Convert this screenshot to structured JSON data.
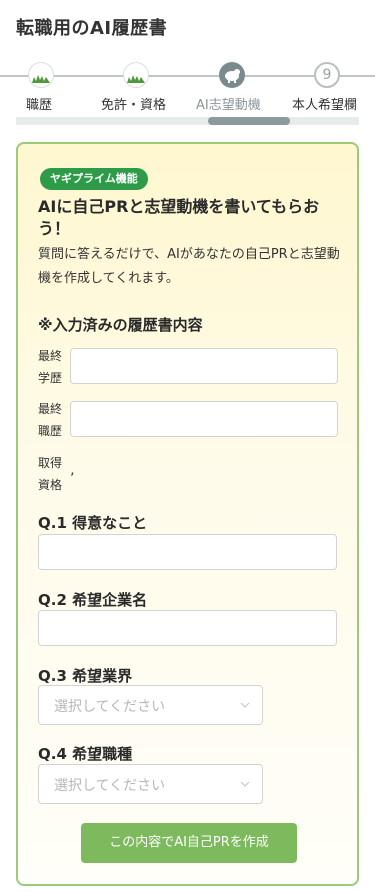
{
  "page": {
    "title": "転職用のAI履歴書"
  },
  "stepper": {
    "steps": [
      {
        "label": "職歴",
        "state": "done"
      },
      {
        "label": "免許・資格",
        "state": "done"
      },
      {
        "label": "AI志望動機",
        "state": "current"
      },
      {
        "label": "本人希望欄",
        "state": "future",
        "number": "9"
      }
    ]
  },
  "card": {
    "badge": "ヤギプライム機能",
    "title": "AIに自己PRと志望動機を書いてもらおう！",
    "description": "質問に答えるだけで、AIがあなたの自己PRと志望動機を作成してくれます。",
    "section_heading": "※入力済みの履歴書内容",
    "rows": [
      {
        "label": "最終学歴",
        "value": ""
      },
      {
        "label": "最終職歴",
        "value": ""
      },
      {
        "label": "取得資格",
        "value": "’"
      }
    ],
    "questions": [
      {
        "label": "Q.1 得意なこと",
        "value": ""
      },
      {
        "label": "Q.2 希望企業名",
        "value": ""
      },
      {
        "label": "Q.3 希望業界",
        "placeholder": "選択してください"
      },
      {
        "label": "Q.4 希望職種",
        "placeholder": "選択してください"
      }
    ],
    "submit_label": "この内容でAI自己PRを作成"
  },
  "colors": {
    "accent_green": "#7dba5e",
    "badge_green": "#2e9b48",
    "card_border": "#9cc97a",
    "stepper_current": "#7b8a8f"
  },
  "icons": {
    "done_step": "grass-icon",
    "current_step": "goat-icon",
    "select_arrow": "chevron-down-icon"
  }
}
